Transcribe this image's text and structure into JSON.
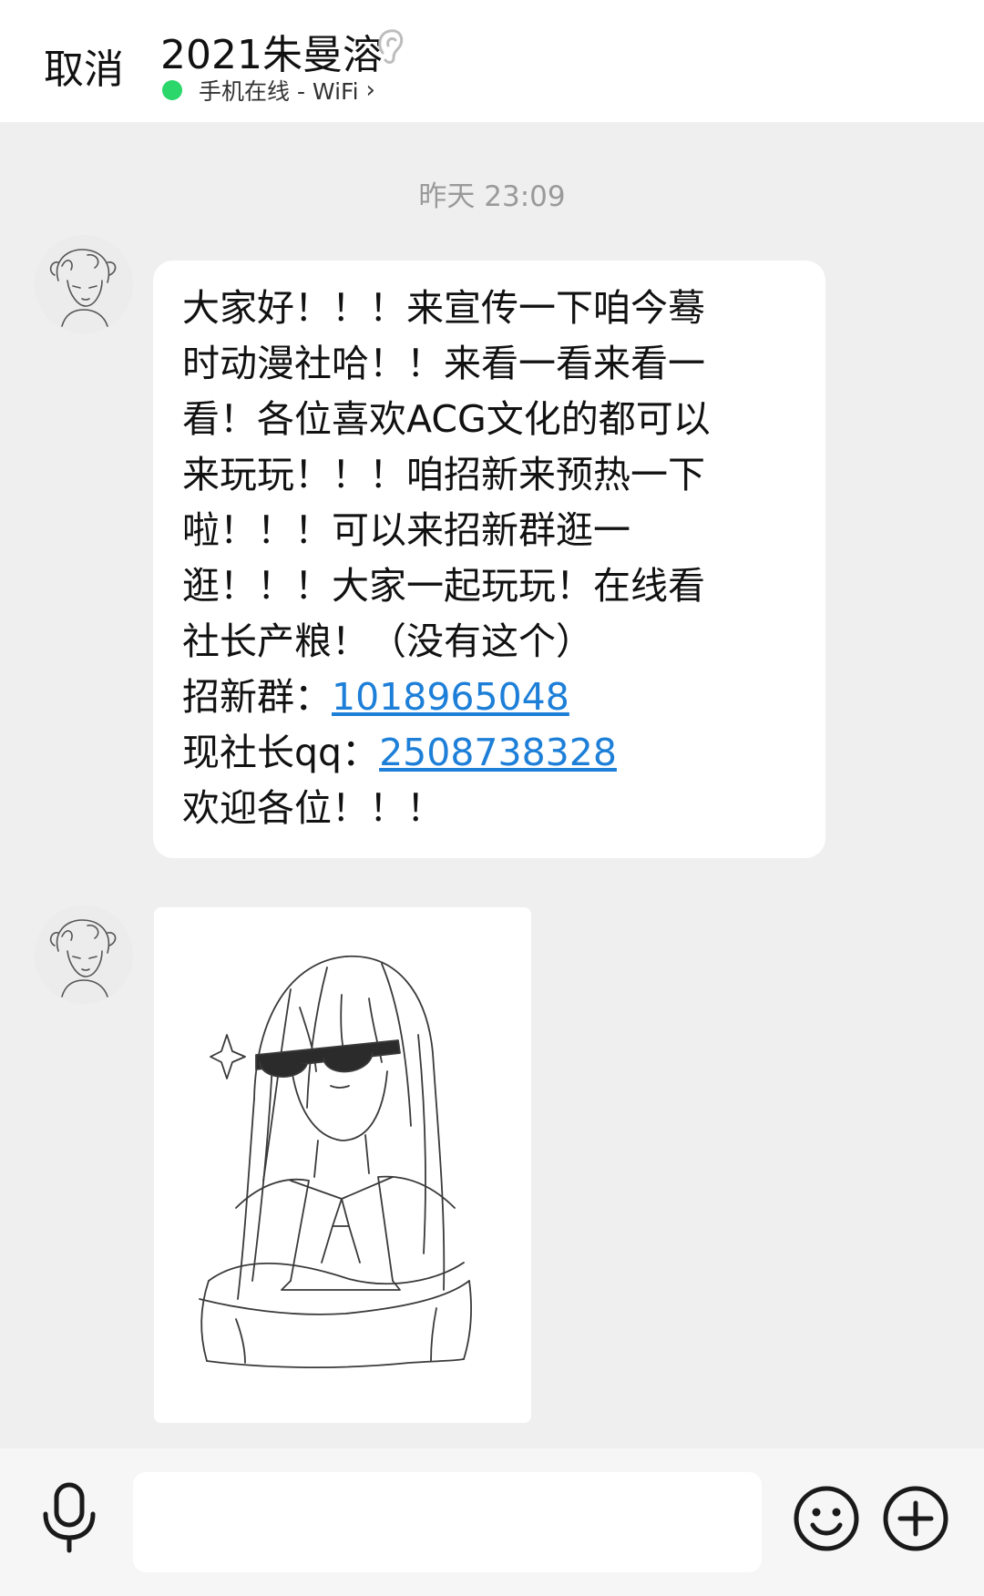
{
  "header": {
    "cancel_label": "取消",
    "contact_name": "2021朱曼溶",
    "status_text": "手机在线 - WiFi",
    "status_color": "#2bd66b",
    "icons": {
      "ear": "ear-icon",
      "chevron": "chevron-right-icon"
    }
  },
  "chat": {
    "timestamp": "昨天 23:09",
    "message": {
      "lines": [
        "大家好！！！来宣传一下咱今蓦",
        "时动漫社哈！！来看一看来看一",
        "看！各位喜欢ACG文化的都可以",
        "来玩玩！！！咱招新来预热一下",
        "啦！！！可以来招新群逛一",
        "逛！！！大家一起玩玩！在线看",
        "社长产粮！（没有这个）"
      ],
      "group_label": "招新群：",
      "group_number": "1018965048",
      "qq_label": "现社长qq：",
      "qq_number": "2508738328",
      "closing": "欢迎各位！！！",
      "link_color": "#1d7fd8"
    },
    "image_message": {
      "description_icon": "sketch-image"
    }
  },
  "input_bar": {
    "placeholder": "",
    "icons": {
      "voice": "microphone-icon",
      "emoji": "emoji-icon",
      "more": "plus-icon"
    }
  }
}
